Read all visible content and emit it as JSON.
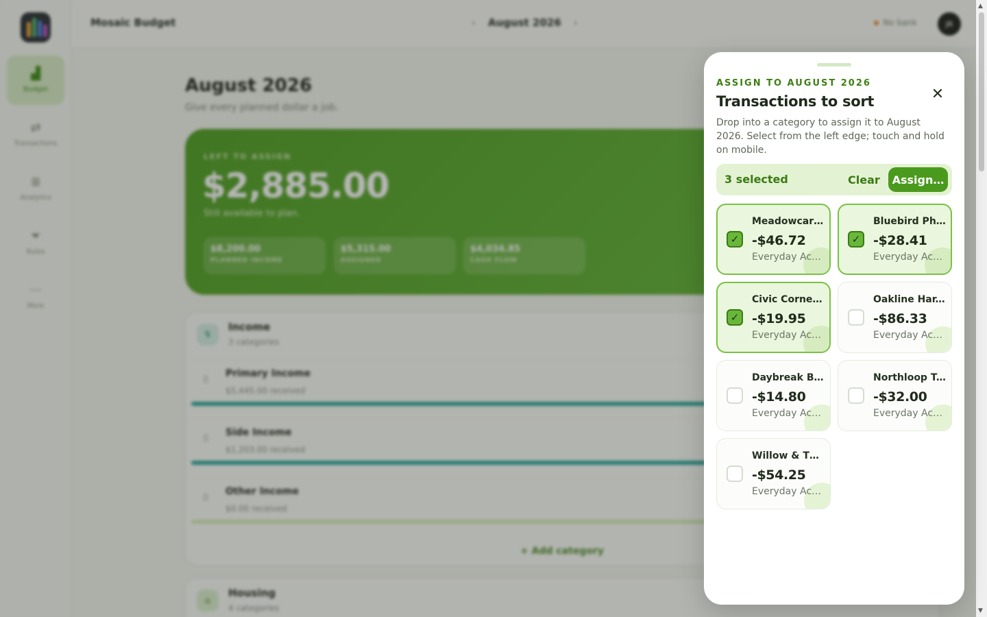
{
  "app": {
    "title": "Mosaic Budget",
    "month": "August 2026",
    "prev_icon": "chevron-left-icon",
    "next_icon": "chevron-right-icon",
    "bank_status": "No bank",
    "avatar_initials": "JR"
  },
  "sidebar": {
    "items": [
      {
        "label": "Budget",
        "icon": "chart-icon",
        "glyph": "▟",
        "active": true
      },
      {
        "label": "Transactions",
        "icon": "swap-icon",
        "glyph": "⇄",
        "active": false
      },
      {
        "label": "Analytics",
        "icon": "analytics-icon",
        "glyph": "≣",
        "active": false
      },
      {
        "label": "Rules",
        "icon": "filter-icon",
        "glyph": "⏷",
        "active": false
      },
      {
        "label": "More",
        "icon": "more-icon",
        "glyph": "···",
        "active": false
      }
    ]
  },
  "page": {
    "title": "August 2026",
    "subtitle": "Give every planned dollar a job."
  },
  "hero": {
    "kicker": "LEFT TO ASSIGN",
    "amount": "$2,885.00",
    "subtitle": "Still available to plan.",
    "stats": [
      {
        "value": "$8,200.00",
        "label": "PLANNED INCOME"
      },
      {
        "value": "$5,315.00",
        "label": "ASSIGNED"
      },
      {
        "value": "$4,034.85",
        "label": "CASH FLOW"
      }
    ]
  },
  "income_group": {
    "title": "Income",
    "subtitle": "3 categories",
    "icon": "income-icon",
    "categories": [
      {
        "name": "Primary Income",
        "sub": "$5,445.00 received"
      },
      {
        "name": "Side Income",
        "sub": "$1,203.00 received"
      },
      {
        "name": "Other Income",
        "sub": "$0.00 received"
      }
    ],
    "add_label": "+ Add category"
  },
  "housing_group": {
    "title": "Housing",
    "subtitle": "4 categories",
    "icon": "house-icon"
  },
  "drawer": {
    "kicker": "ASSIGN TO AUGUST 2026",
    "title": "Transactions to sort",
    "description": "Drop into a category to assign it to August 2026. Select from the left edge; touch and hold on mobile.",
    "close_icon": "close-icon",
    "close_glyph": "✕",
    "selected_text": "3 selected",
    "clear_label": "Clear",
    "assign_label": "Assign…",
    "accent_color": "#4a9a1e",
    "transactions": [
      {
        "merchant": "Meadowcart ...",
        "amount": "-$46.72",
        "account": "Everyday Acco...",
        "selected": true
      },
      {
        "merchant": "Bluebird Pha...",
        "amount": "-$28.41",
        "account": "Everyday Acco...",
        "selected": true
      },
      {
        "merchant": "Civic Corner ...",
        "amount": "-$19.95",
        "account": "Everyday Acco...",
        "selected": true
      },
      {
        "merchant": "Oakline Har...",
        "amount": "-$86.33",
        "account": "Everyday Acco...",
        "selected": false
      },
      {
        "merchant": "Daybreak Ba...",
        "amount": "-$14.80",
        "account": "Everyday Acco...",
        "selected": false
      },
      {
        "merchant": "Northloop Tr...",
        "amount": "-$32.00",
        "account": "Everyday Acco...",
        "selected": false
      },
      {
        "merchant": "Willow & Thr...",
        "amount": "-$54.25",
        "account": "Everyday Acco...",
        "selected": false
      }
    ]
  }
}
